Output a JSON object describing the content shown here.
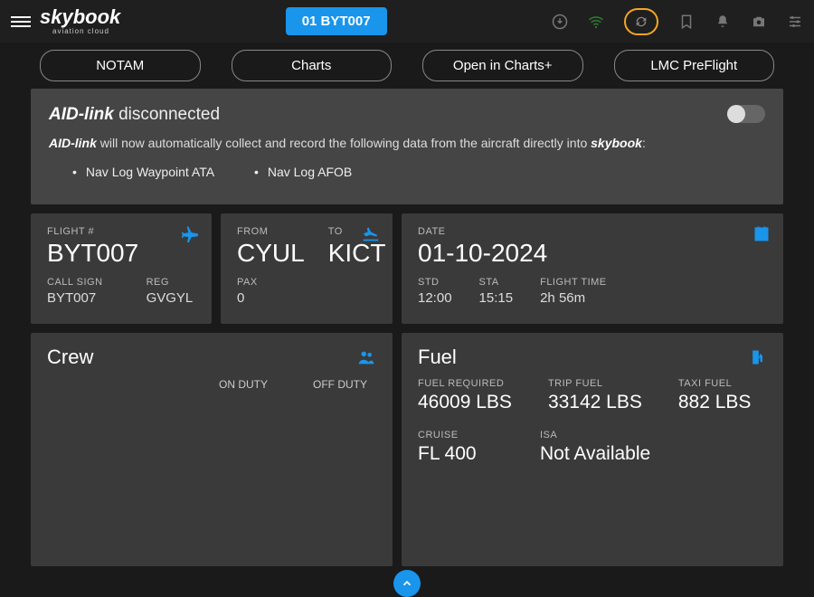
{
  "header": {
    "brand": "skybook",
    "tagline": "aviation cloud",
    "flight_pill": "01 BYT007"
  },
  "tabs": {
    "notam": "NOTAM",
    "charts": "Charts",
    "open_charts": "Open in Charts+",
    "lmc": "LMC PreFlight"
  },
  "aid": {
    "title_brand": "AID-link",
    "title_status": "disconnected",
    "desc_prefix": "AID-link",
    "desc_mid": " will now automatically collect and record the following data from the aircraft directly into ",
    "desc_brand2": "skybook",
    "desc_suffix": ":",
    "bullet1": "Nav Log Waypoint ATA",
    "bullet2": "Nav Log AFOB"
  },
  "flight": {
    "flight_label": "FLIGHT #",
    "flight_value": "BYT007",
    "callsign_label": "CALL SIGN",
    "callsign_value": "BYT007",
    "reg_label": "REG",
    "reg_value": "GVGYL"
  },
  "route": {
    "from_label": "FROM",
    "from_value": "CYUL",
    "to_label": "TO",
    "to_value": "KICT",
    "pax_label": "PAX",
    "pax_value": "0"
  },
  "date": {
    "date_label": "DATE",
    "date_value": "01-10-2024",
    "std_label": "STD",
    "std_value": "12:00",
    "sta_label": "STA",
    "sta_value": "15:15",
    "ft_label": "FLIGHT TIME",
    "ft_value": "2h 56m"
  },
  "crew": {
    "title": "Crew",
    "on_duty": "ON DUTY",
    "off_duty": "OFF DUTY"
  },
  "fuel": {
    "title": "Fuel",
    "req_label": "FUEL REQUIRED",
    "req_value": "46009 LBS",
    "trip_label": "TRIP FUEL",
    "trip_value": "33142 LBS",
    "taxi_label": "TAXI FUEL",
    "taxi_value": "882 LBS",
    "cruise_label": "CRUISE",
    "cruise_value": "FL 400",
    "isa_label": "ISA",
    "isa_value": "Not Available"
  }
}
